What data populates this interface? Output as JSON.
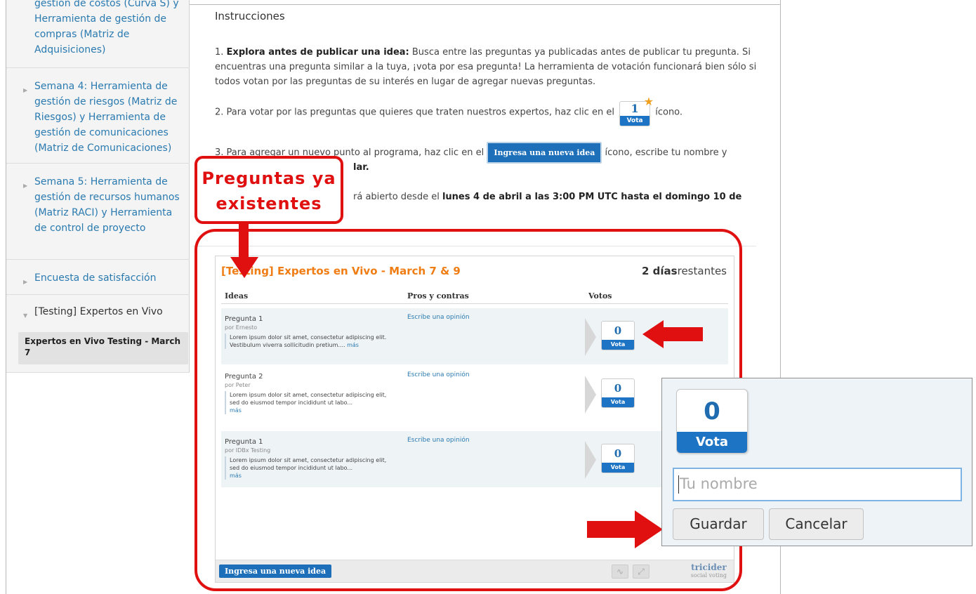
{
  "sidebar": {
    "items": [
      {
        "label": "gestión de costos (Curva S) y Herramienta de gestión de compras (Matriz de Adquisiciones)"
      },
      {
        "label": "Semana 4: Herramienta de gestión de riesgos (Matriz de Riesgos) y Herramienta de gestión de comunicaciones (Matriz de Comunicaciones)"
      },
      {
        "label": "Semana 5: Herramienta de gestión de recursos humanos (Matriz RACI) y Herramienta de control de proyecto"
      },
      {
        "label": "Encuesta de satisfacción"
      },
      {
        "label": "[Testing] Expertos en Vivo"
      }
    ],
    "current": "Expertos en Vivo Testing - March 7"
  },
  "main": {
    "title": "Instrucciones",
    "step1_num": "1.",
    "step1_bold": "Explora antes de publicar una idea:",
    "step1_text": "Busca entre las preguntas ya publicadas antes de publicar tu pregunta. Si encuentras una pregunta similar a la tuya, ¡vota por esa pregunta! La herramienta de votación funcionará bien sólo si todos votan por las preguntas de su interés en lugar de agregar nuevas preguntas.",
    "step2_text": "2. Para votar por las preguntas que quieres que traten nuestros expertos, haz clic en el",
    "step2_after": "ícono.",
    "step3_text": "3. Para agregar un nuevo punto al programa, haz clic en el",
    "step3_after": "ícono, escribe tu nombre y",
    "step3_line2": "lar.",
    "step4_text": "rá abierto desde el",
    "step4_bold": "lunes 4 de abril a las 3:00 PM UTC hasta el domingo 10 de",
    "vote_icon": {
      "num": "1",
      "label": "Vota"
    },
    "ingresa_label": "Ingresa una nueva idea"
  },
  "widget": {
    "title": "[Testing] Expertos en Vivo - March 7 & 9",
    "remaining_bold": "2 días",
    "remaining_text": "restantes",
    "col_ideas": "Ideas",
    "col_pros": "Pros y contras",
    "col_votos": "Votos",
    "rows": [
      {
        "q": "Pregunta 1",
        "by": "por Ernesto",
        "text": "Lorem ipsum dolor sit amet, consectetur adipiscing elit. Vestibulum viverra sollicitudin pretium....",
        "more": "más",
        "opinion": "Escribe una opinión",
        "votes": "0",
        "vote_label": "Vota"
      },
      {
        "q": "Pregunta 2",
        "by": "por Peter",
        "text": "Lorem ipsum dolor sit amet, consectetur adipiscing elit, sed do eiusmod tempor incididunt ut labo...",
        "more": "más",
        "opinion": "Escribe una opinión",
        "votes": "0",
        "vote_label": "Vota"
      },
      {
        "q": "Pregunta 1",
        "by": "por IDBx Testing",
        "text": "Lorem ipsum dolor sit amet, consectetur adipiscing elit, sed do eiusmod tempor incididunt ut labo...",
        "more": "más",
        "opinion": "Escribe una opinión",
        "votes": "0",
        "vote_label": "Vota"
      }
    ],
    "add_button": "Ingresa una nueva idea",
    "brand": "tricider",
    "brand_sub": "social voting"
  },
  "annotation": {
    "label_line1": "Preguntas ya",
    "label_line2": "existentes",
    "color": "#e01010"
  },
  "zoom": {
    "votes": "0",
    "vote_label": "Vota",
    "name_placeholder": "Tu nombre",
    "save": "Guardar",
    "cancel": "Cancelar"
  }
}
